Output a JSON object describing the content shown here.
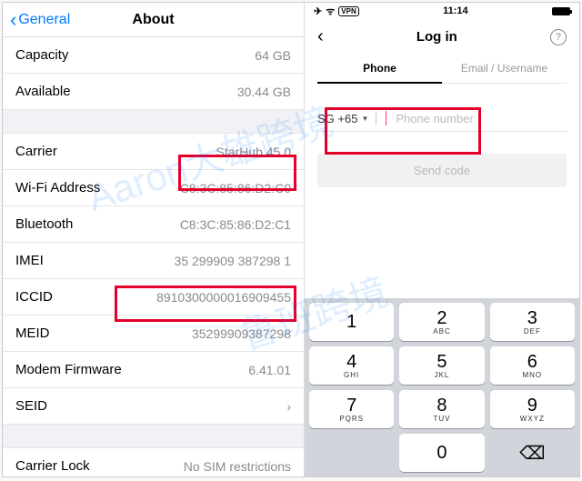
{
  "left": {
    "back": "General",
    "title": "About",
    "rows": [
      {
        "label": "Capacity",
        "value": "64 GB"
      },
      {
        "label": "Available",
        "value": "30.44 GB"
      },
      {
        "gap": true
      },
      {
        "label": "Carrier",
        "value": "StarHub 45.0"
      },
      {
        "label": "Wi-Fi Address",
        "value": "C8:3C:85:86:D2:C0"
      },
      {
        "label": "Bluetooth",
        "value": "C8:3C:85:86:D2:C1"
      },
      {
        "label": "IMEI",
        "value": "35 299909 387298 1"
      },
      {
        "label": "ICCID",
        "value": "8910300000016909455"
      },
      {
        "label": "MEID",
        "value": "35299909387298"
      },
      {
        "label": "Modem Firmware",
        "value": "6.41.01"
      },
      {
        "label": "SEID",
        "value": "›"
      },
      {
        "gap": true
      },
      {
        "label": "Carrier Lock",
        "value": "No SIM restrictions"
      }
    ]
  },
  "right": {
    "status": {
      "plane": "✈",
      "wifi": "ᯤ",
      "vpn": "VPN",
      "time": "11:14"
    },
    "title": "Log in",
    "help": "?",
    "tabs": {
      "phone": "Phone",
      "email": "Email / Username"
    },
    "country": "SG +65",
    "placeholder": "Phone number",
    "send": "Send code",
    "keys": [
      {
        "n": "1",
        "l": ""
      },
      {
        "n": "2",
        "l": "ABC"
      },
      {
        "n": "3",
        "l": "DEF"
      },
      {
        "n": "4",
        "l": "GHI"
      },
      {
        "n": "5",
        "l": "JKL"
      },
      {
        "n": "6",
        "l": "MNO"
      },
      {
        "n": "7",
        "l": "PQRS"
      },
      {
        "n": "8",
        "l": "TUV"
      },
      {
        "n": "9",
        "l": "WXYZ"
      },
      {
        "blank": true
      },
      {
        "n": "0",
        "l": ""
      },
      {
        "del": true,
        "sym": "⌫"
      }
    ]
  },
  "watermark": {
    "a": "Aaron大雄跨境",
    "b": "鲁班跨境"
  }
}
